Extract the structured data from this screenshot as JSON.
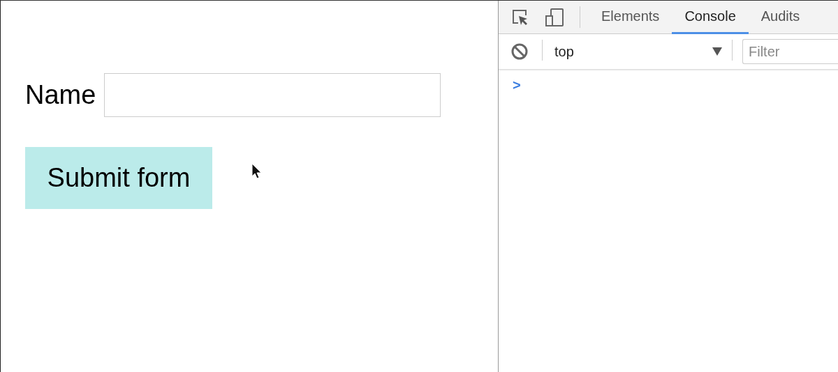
{
  "page": {
    "name_label": "Name",
    "submit_button": "Submit form"
  },
  "devtools": {
    "tabs": [
      {
        "label": "Elements",
        "selected": false
      },
      {
        "label": "Console",
        "selected": true
      },
      {
        "label": "Audits",
        "selected": false
      }
    ],
    "context": "top",
    "filter": {
      "placeholder": "Filter"
    },
    "prompt": ">"
  }
}
